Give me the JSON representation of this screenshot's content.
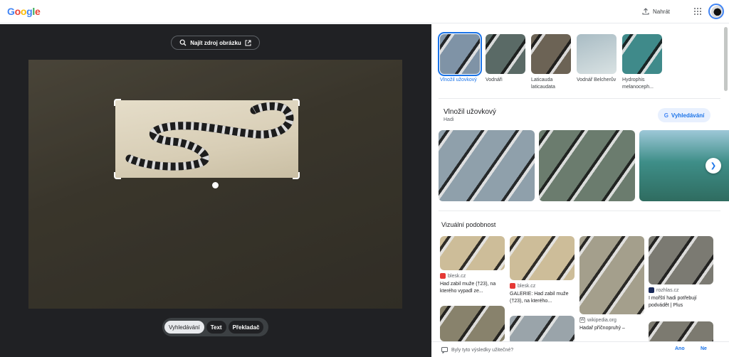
{
  "header": {
    "logo": "Google",
    "upload_label": "Nahrát"
  },
  "left": {
    "find_source": "Najít zdroj obrázku",
    "modes": [
      "Vyhledávání",
      "Text",
      "Překladač"
    ]
  },
  "chips": [
    {
      "label": "Vlnožil užovkový"
    },
    {
      "label": "Vodnáři"
    },
    {
      "label": "Laticauda laticaudata"
    },
    {
      "label": "Vodnář Belcherův"
    },
    {
      "label": "Hydrophis melanoceph..."
    }
  ],
  "knowledge": {
    "title": "Vlnožil užovkový",
    "subtitle": "Hadi",
    "search_button": "Vyhledávání"
  },
  "visual": {
    "title": "Vizuální podobnost",
    "cards": [
      {
        "source": "blesk.cz",
        "title": "Had zabil muže (†23), na kterého vypadl ze..."
      },
      {
        "source": "blesk.cz",
        "title": "GALERIE: Had zabil muže (†23), na kterého..."
      },
      {
        "source": "wikipedia.org",
        "title": "Hadař příčnopruhý –"
      },
      {
        "source": "rozhlas.cz",
        "title": "I mořští hadi potřebují podvádět | Plus"
      }
    ]
  },
  "footer": {
    "question": "Byly tyto výsledky užitečné?",
    "yes": "Ano",
    "no": "Ne"
  },
  "colors": {
    "accent": "#1a73e8",
    "dark_panel": "#202124"
  }
}
